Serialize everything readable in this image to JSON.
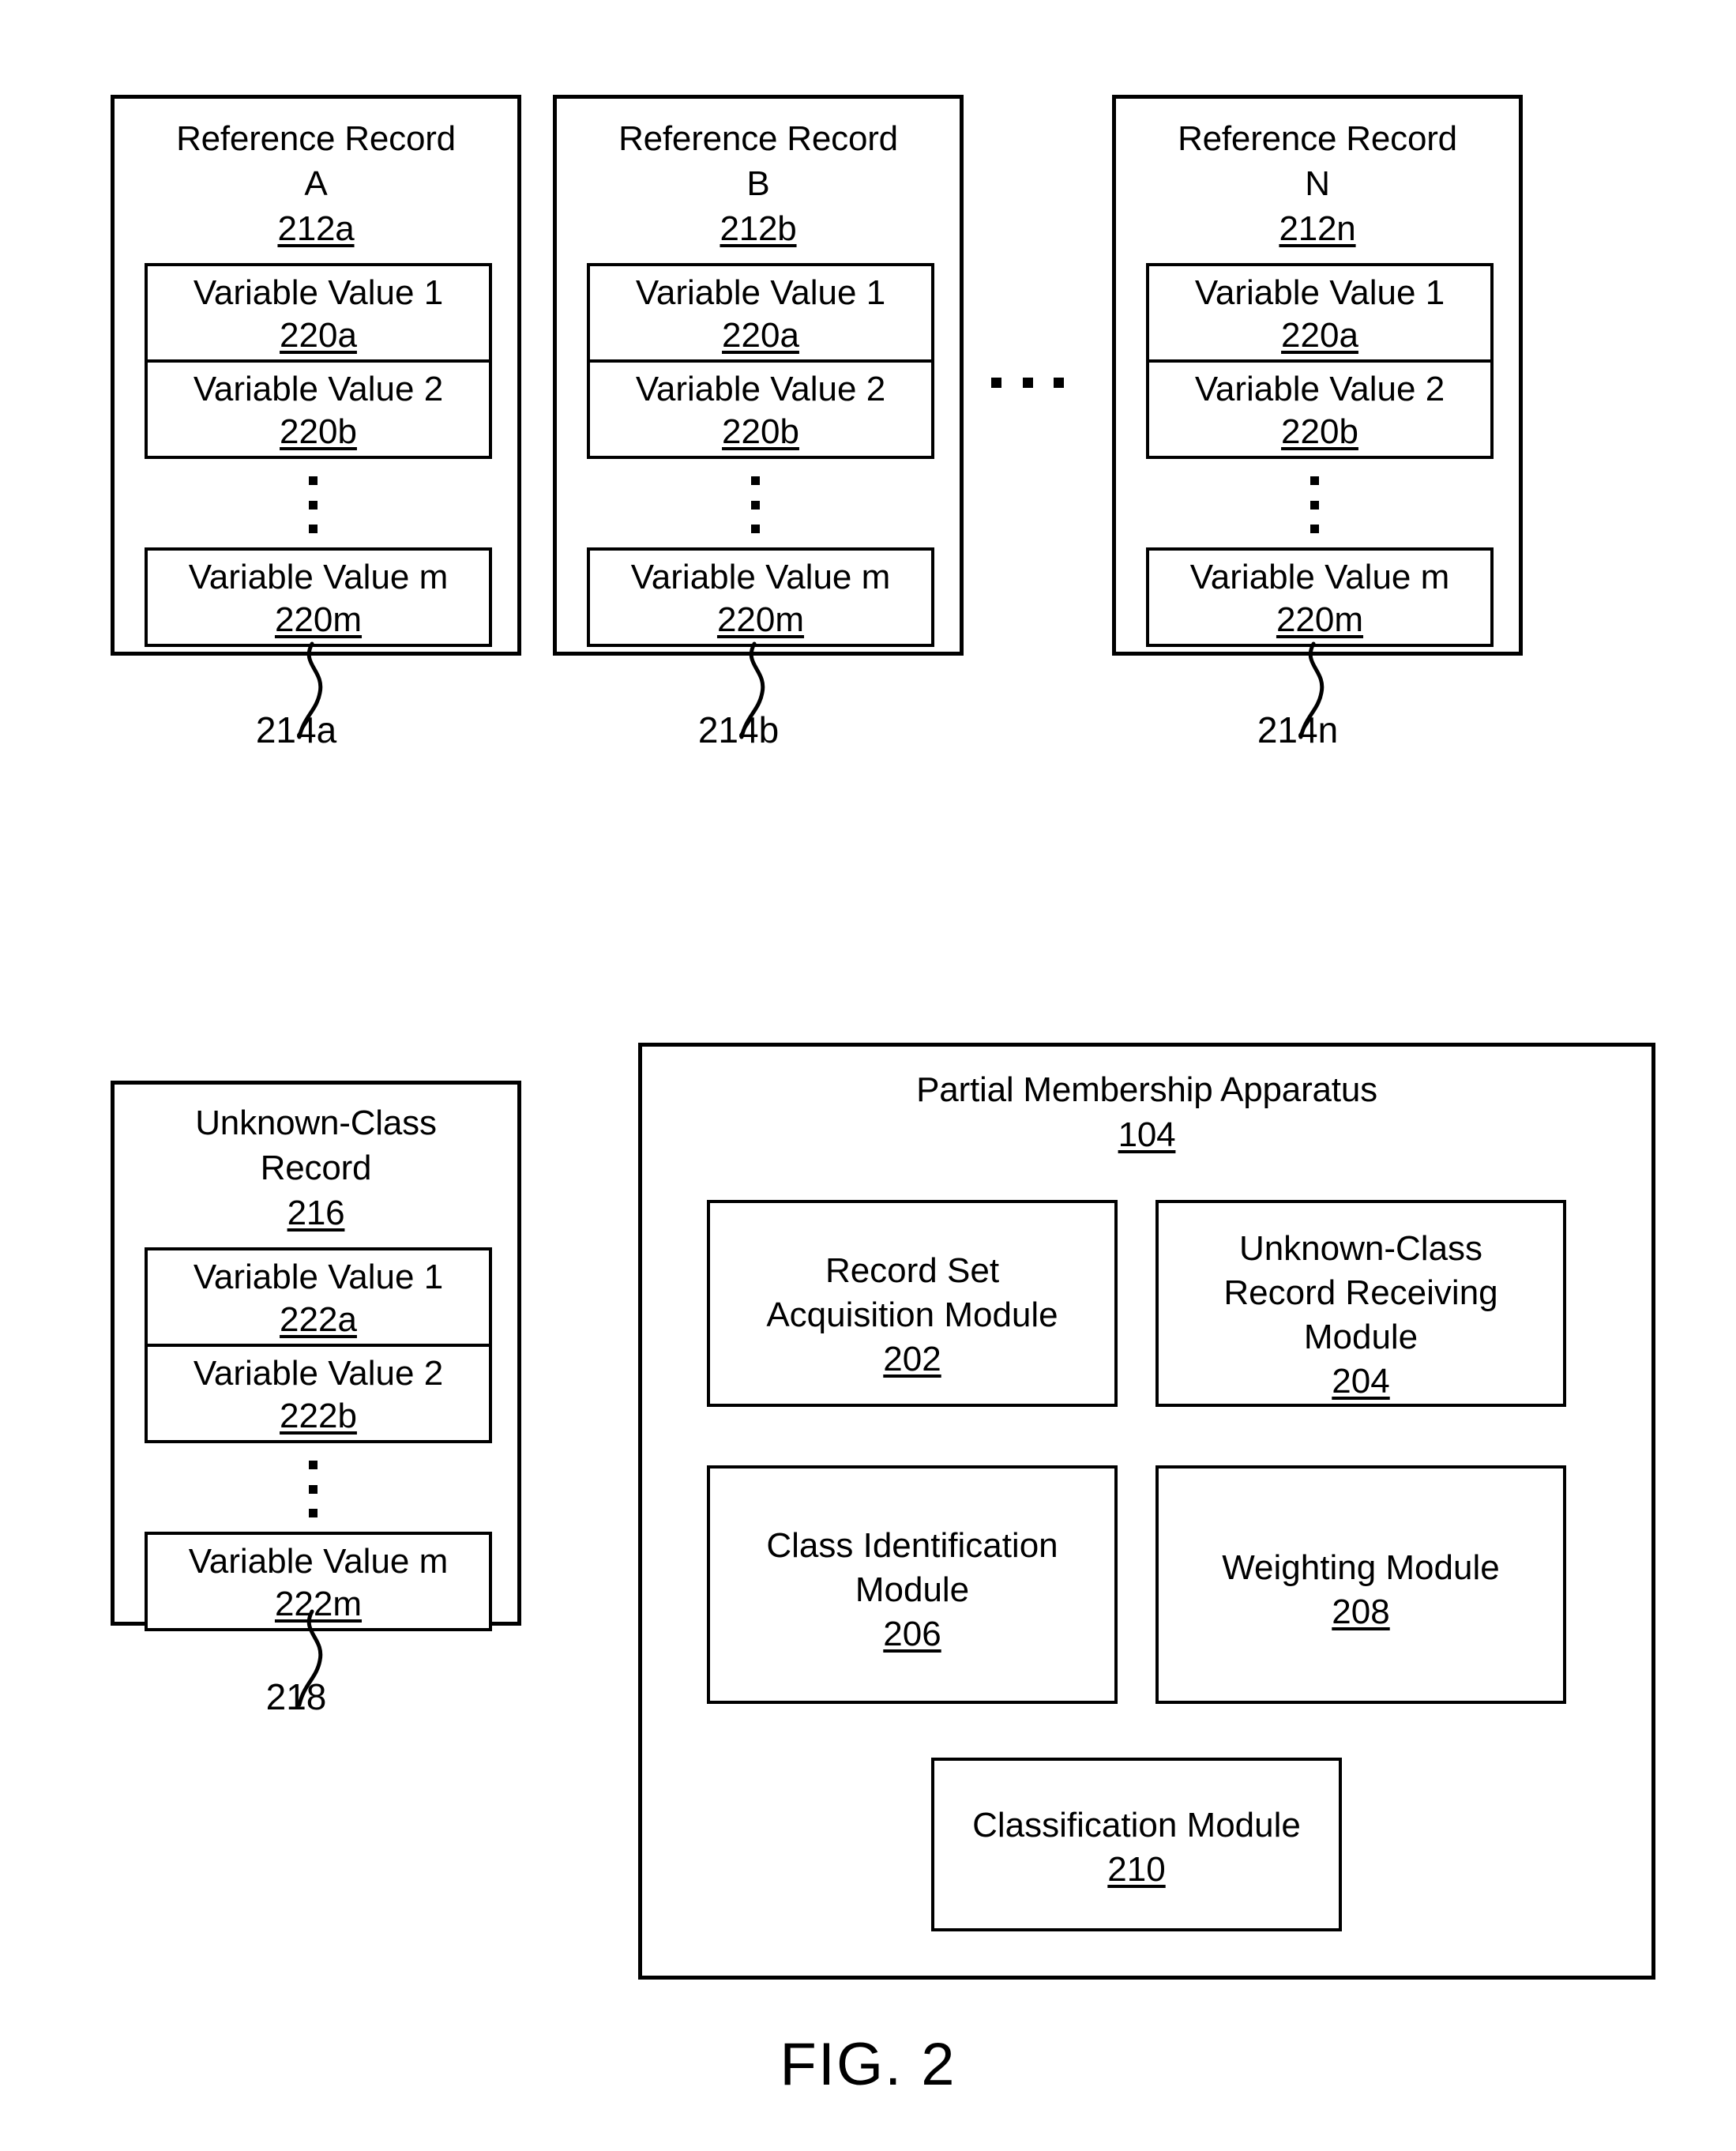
{
  "figure": {
    "caption": "FIG. 2"
  },
  "reference_records": [
    {
      "title_line1": "Reference Record",
      "title_line2": "A",
      "ref_number": "212a",
      "variables": [
        {
          "label": "Variable Value 1",
          "ref": "220a"
        },
        {
          "label": "Variable Value 2",
          "ref": "220b"
        },
        {
          "label": "Variable Value m",
          "ref": "220m"
        }
      ],
      "leader_label": "214a"
    },
    {
      "title_line1": "Reference Record",
      "title_line2": "B",
      "ref_number": "212b",
      "variables": [
        {
          "label": "Variable Value 1",
          "ref": "220a"
        },
        {
          "label": "Variable Value 2",
          "ref": "220b"
        },
        {
          "label": "Variable Value m",
          "ref": "220m"
        }
      ],
      "leader_label": "214b"
    },
    {
      "title_line1": "Reference Record",
      "title_line2": "N",
      "ref_number": "212n",
      "variables": [
        {
          "label": "Variable Value 1",
          "ref": "220a"
        },
        {
          "label": "Variable Value 2",
          "ref": "220b"
        },
        {
          "label": "Variable Value m",
          "ref": "220m"
        }
      ],
      "leader_label": "214n"
    }
  ],
  "unknown_class_record": {
    "title_line1": "Unknown-Class",
    "title_line2": "Record",
    "ref_number": "216",
    "variables": [
      {
        "label": "Variable Value 1",
        "ref": "222a"
      },
      {
        "label": "Variable Value 2",
        "ref": "222b"
      },
      {
        "label": "Variable Value m",
        "ref": "222m"
      }
    ],
    "leader_label": "218"
  },
  "apparatus": {
    "title": "Partial Membership Apparatus",
    "ref_number": "104",
    "modules": [
      {
        "line1": "Record Set",
        "line2": "Acquisition Module",
        "line3": "",
        "ref": "202"
      },
      {
        "line1": "Unknown-Class",
        "line2": "Record Receiving",
        "line3": "Module",
        "ref": "204"
      },
      {
        "line1": "Class Identification",
        "line2": "Module",
        "line3": "",
        "ref": "206"
      },
      {
        "line1": "Weighting Module",
        "line2": "",
        "line3": "",
        "ref": "208"
      },
      {
        "line1": "Classification Module",
        "line2": "",
        "line3": "",
        "ref": "210"
      }
    ]
  },
  "ellipsis": {
    "vertical": "vertical-ellipsis",
    "horizontal": "horizontal-ellipsis"
  },
  "colors": {
    "stroke": "#000000",
    "background": "#ffffff"
  }
}
